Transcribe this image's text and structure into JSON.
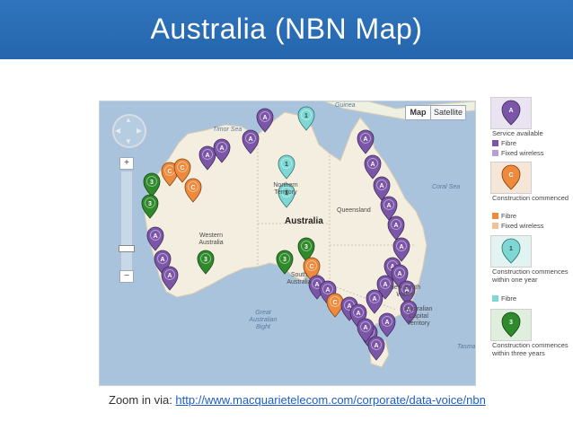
{
  "slide": {
    "title": "Australia (NBN Map)"
  },
  "map": {
    "type_buttons": [
      "Map",
      "Satellite"
    ],
    "labels": {
      "guinea": "Guinea",
      "timor_sea": "Timor Sea",
      "coral_sea": "Coral Sea",
      "northern_territory": "Northern Territory",
      "queensland": "Queensland",
      "australia": "Australia",
      "western_australia": "Western Australia",
      "south_australia": "South Australia",
      "new_south_wales": "New South Wales",
      "australian_capital_territory": "Australian Capital Territory",
      "great_australian_bight": "Great Australian Bight",
      "tasman": "Tasma"
    },
    "pins": [
      {
        "label": "A",
        "status": "service-fibre"
      },
      {
        "label": "1",
        "status": "commences-one-year"
      },
      {
        "label": "A",
        "status": "service-fibre"
      },
      {
        "label": "A",
        "status": "service-fibre"
      },
      {
        "label": "A",
        "status": "service-fibre"
      },
      {
        "label": "C",
        "status": "construction-fibre"
      },
      {
        "label": "C",
        "status": "construction-fibre"
      },
      {
        "label": "C",
        "status": "construction-fibre"
      },
      {
        "label": "3",
        "status": "commences-three-years"
      },
      {
        "label": "3",
        "status": "commences-three-years"
      },
      {
        "label": "1",
        "status": "commences-one-year"
      },
      {
        "label": "1",
        "status": "commences-one-year"
      },
      {
        "label": "A",
        "status": "service-fibre"
      },
      {
        "label": "A",
        "status": "service-fibre"
      },
      {
        "label": "A",
        "status": "service-fibre"
      },
      {
        "label": "3",
        "status": "commences-three-years"
      },
      {
        "label": "A",
        "status": "service-fibre"
      },
      {
        "label": "A",
        "status": "service-fibre"
      },
      {
        "label": "A",
        "status": "service-fibre"
      },
      {
        "label": "A",
        "status": "service-fibre"
      },
      {
        "label": "A",
        "status": "service-fibre"
      },
      {
        "label": "A",
        "status": "service-fibre"
      },
      {
        "label": "A",
        "status": "service-fibre"
      },
      {
        "label": "A",
        "status": "service-fibre"
      },
      {
        "label": "A",
        "status": "service-fibre"
      },
      {
        "label": "3",
        "status": "commences-three-years"
      },
      {
        "label": "3",
        "status": "commences-three-years"
      },
      {
        "label": "C",
        "status": "construction-fibre"
      },
      {
        "label": "A",
        "status": "service-fibre"
      },
      {
        "label": "A",
        "status": "service-fibre"
      },
      {
        "label": "C",
        "status": "construction-fibre"
      },
      {
        "label": "A",
        "status": "service-fibre"
      },
      {
        "label": "A",
        "status": "service-fibre"
      },
      {
        "label": "A",
        "status": "service-fibre"
      },
      {
        "label": "A",
        "status": "service-fibre"
      },
      {
        "label": "A",
        "status": "service-fibre"
      },
      {
        "label": "A",
        "status": "service-fibre"
      },
      {
        "label": "A",
        "status": "service-fibre"
      },
      {
        "label": "A",
        "status": "service-fibre"
      },
      {
        "label": "A",
        "status": "service-fibre"
      }
    ]
  },
  "legend": {
    "service_available": "Service available",
    "service_fibre": "Fibre",
    "service_fixed_wireless": "Fixed wireless",
    "construction_commenced": "Construction commenced",
    "construction_fibre": "Fibre",
    "construction_fixed_wireless": "Fixed wireless",
    "one_year": "Construction commences within one year",
    "one_year_fibre": "Fibre",
    "three_years": "Construction commences within three years",
    "colors": {
      "service_fibre": "#7b55a8",
      "service_fixed_wireless": "#b6a0d4",
      "construction_fibre": "#ef8a3c",
      "construction_fixed_wireless": "#f1c19a",
      "one_year_fibre": "#7ed7d3",
      "three_years": "#2f8a2c"
    }
  },
  "caption": {
    "prefix": "Zoom in via: ",
    "link": "http://www.macquarietelecom.com/corporate/data-voice/nbn"
  }
}
